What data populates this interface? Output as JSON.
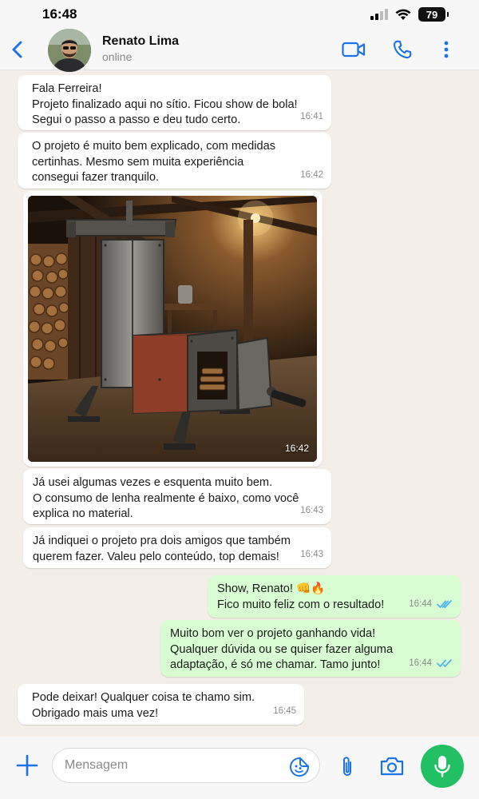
{
  "status_bar": {
    "time": "16:48",
    "battery": "79"
  },
  "header": {
    "contact_name": "Renato Lima",
    "contact_status": "online"
  },
  "messages": [
    {
      "direction": "in",
      "text": "Fala Ferreira!\nProjeto finalizado aqui no sítio. Ficou show de bola!\nSegui o passo a passo e deu tudo certo.",
      "time": "16:41"
    },
    {
      "direction": "in",
      "text": "O projeto é muito bem explicado, com medidas\ncertinhas. Mesmo sem muita experiência\nconsegui fazer tranquilo.",
      "time": "16:42"
    },
    {
      "direction": "in",
      "type": "image",
      "time": "16:42"
    },
    {
      "direction": "in",
      "text": "Já usei algumas vezes e esquenta muito bem.\nO consumo de lenha realmente é baixo, como você\nexplica no material.",
      "time": "16:43"
    },
    {
      "direction": "in",
      "text": "Já indiquei o projeto pra dois amigos que também\nquerem fazer. Valeu pelo conteúdo, top demais!",
      "time": "16:43"
    },
    {
      "direction": "out",
      "text": "Show, Renato! 👊🔥\nFico muito feliz com o resultado!",
      "time": "16:44",
      "read": true
    },
    {
      "direction": "out",
      "text": "Muito bom ver o projeto ganhando vida!\nQualquer dúvida ou se quiser fazer alguma\nadaptação, é só me chamar. Tamo junto!",
      "time": "16:44",
      "read": true
    },
    {
      "direction": "in",
      "text": "Pode deixar! Qualquer coisa te chamo sim.\nObrigado mais uma vez!",
      "time": "16:45"
    }
  ],
  "composer": {
    "placeholder": "Mensagem"
  },
  "colors": {
    "accent": "#1a73e8",
    "outgoing_bubble": "#d9fdd3",
    "incoming_bubble": "#ffffff",
    "mic_button": "#21c063",
    "read_ticks": "#4fb6ec"
  }
}
